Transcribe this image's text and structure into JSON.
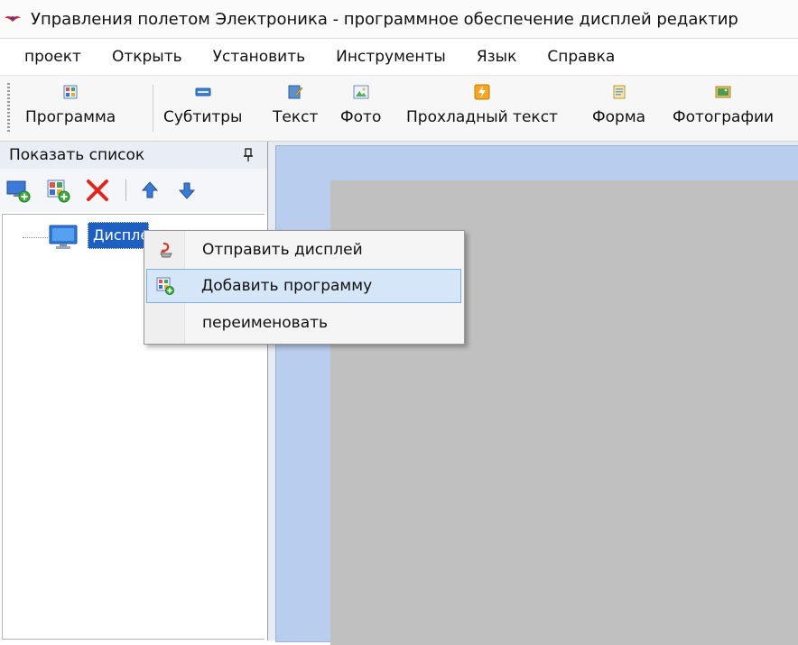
{
  "window": {
    "title": "Управления полетом Электроника - программное обеспечение дисплей редактир"
  },
  "menu": {
    "items": [
      "проект",
      "Открыть",
      "Установить",
      "Инструменты",
      "Язык",
      "Справка"
    ]
  },
  "toolbar": {
    "buttons": [
      {
        "label": "Программа",
        "icon": "program-icon"
      },
      {
        "label": "Субтитры",
        "icon": "subtitles-icon"
      },
      {
        "label": "Текст",
        "icon": "text-icon"
      },
      {
        "label": "Фото",
        "icon": "photo-icon"
      },
      {
        "label": "Прохладный текст",
        "icon": "cool-text-icon"
      },
      {
        "label": "Форма",
        "icon": "form-icon"
      },
      {
        "label": "Фотографии",
        "icon": "photos-icon"
      }
    ]
  },
  "left_panel": {
    "title": "Показать список",
    "tree": {
      "node_label": "Дисплей"
    }
  },
  "context_menu": {
    "items": [
      {
        "label": "Отправить дисплей",
        "icon": "send-display-icon"
      },
      {
        "label": "Добавить программу",
        "icon": "add-program-icon",
        "highlighted": true
      },
      {
        "label": "переименовать",
        "icon": ""
      }
    ]
  },
  "colors": {
    "selection": "#1e5fc4",
    "menu_highlight": "#d5e6f8",
    "canvas_frame": "#b9cdee",
    "canvas_gray": "#c0c0c0"
  }
}
